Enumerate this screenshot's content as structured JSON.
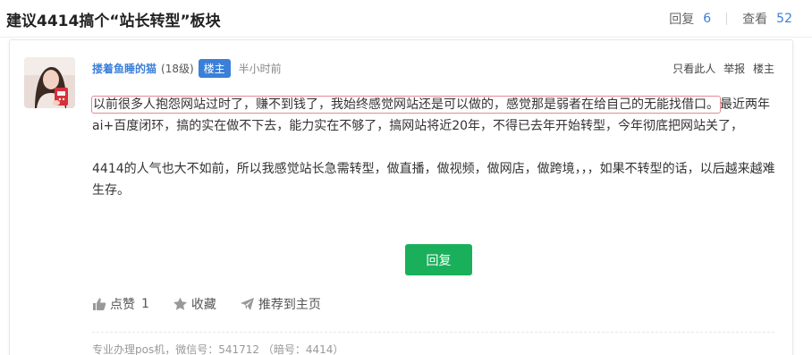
{
  "page": {
    "title": "建议4414搞个“站长转型”板块",
    "reply_label": "回复",
    "reply_count": "6",
    "view_label": "查看",
    "view_count": "52"
  },
  "post": {
    "author": "搂着鱼睡的猫",
    "level": "(18级)",
    "badge": "楼主",
    "time": "半小时前",
    "actions": [
      "只看此人",
      "举报",
      "楼主"
    ],
    "content": {
      "highlighted": "以前很多人抱怨网站过时了，赚不到钱了，我始终感觉网站还是可以做的，感觉那是弱者在给自己的无能找借口。",
      "line1_rest": "最近两年ai+百度闭环，搞的实在做不下去，能力实在不够了，搞网站将近20年，不得已去年开始转型，今年彻底把网站关了，",
      "para2": "4414的人气也大不如前，所以我感觉站长急需转型，做直播，做视频，做网店，做跨境，，，如果不转型的话，以后越来越难生存。"
    },
    "reply_button": "回复",
    "like_label": "点赞",
    "like_count": "1",
    "favorite_label": "收藏",
    "recommend_label": "推荐到主页",
    "signature": "专业办理pos机，微信号：541712 （暗号：4414）",
    "icons": {
      "like": "thumbs-up-icon",
      "favorite": "star-icon",
      "recommend": "paper-plane-icon"
    }
  },
  "colors": {
    "accent": "#3b7fd8",
    "reply_button": "#1ab05b",
    "highlight_border": "#e38a93"
  }
}
